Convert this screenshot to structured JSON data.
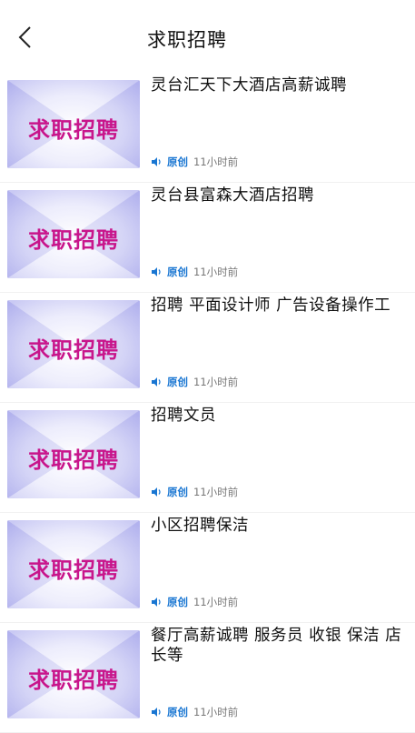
{
  "header": {
    "title": "求职招聘"
  },
  "thumb_text": "求职招聘",
  "accent_color": "#1976d2",
  "thumb_text_color": "#c8158b",
  "items": [
    {
      "title": "灵台汇天下大酒店高薪诚聘",
      "badge": "原创",
      "time": "11小时前"
    },
    {
      "title": "灵台县富森大酒店招聘",
      "badge": "原创",
      "time": "11小时前"
    },
    {
      "title": "招聘 平面设计师 广告设备操作工",
      "badge": "原创",
      "time": "11小时前"
    },
    {
      "title": "招聘文员",
      "badge": "原创",
      "time": "11小时前"
    },
    {
      "title": "小区招聘保洁",
      "badge": "原创",
      "time": "11小时前"
    },
    {
      "title": "餐厅高薪诚聘 服务员 收银 保洁 店长等",
      "badge": "原创",
      "time": "11小时前"
    }
  ]
}
